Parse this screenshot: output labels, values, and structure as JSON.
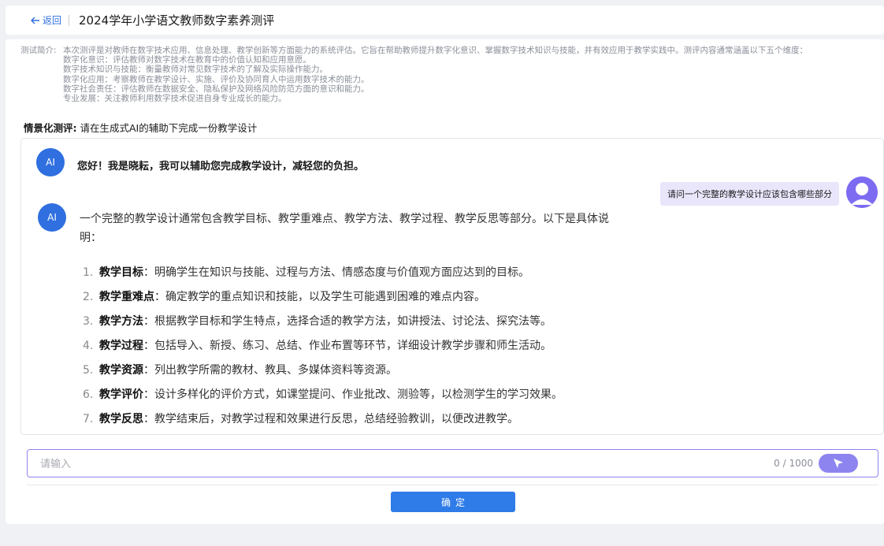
{
  "header": {
    "back_label": "返回",
    "title": "2024学年小学语文教师数字素养测评"
  },
  "intro": {
    "label": "测试简介:",
    "text": "本次测评是对教师在数字技术应用、信息处理、教学创新等方面能力的系统评估。它旨在帮助教师提升数字化意识、掌握数字技术知识与技能，并有效应用于教学实践中。测评内容通常涵盖以下五个维度：",
    "dimensions": [
      "数字化意识：评估教师对数字技术在教育中的价值认知和应用意愿。",
      "数字技术知识与技能：衡量教师对常见数字技术的了解及实际操作能力。",
      "数字化应用：考察教师在教学设计、实施、评价及协同育人中运用数字技术的能力。",
      "数字社会责任：评估教师在数据安全、隐私保护及网络风险防范方面的意识和能力。",
      "专业发展：关注教师利用数字技术促进自身专业成长的能力。"
    ]
  },
  "scenario": {
    "label": "情景化测评:",
    "text": "请在生成式AI的辅助下完成一份教学设计"
  },
  "chat": {
    "ai_avatar": "AI",
    "greeting": "您好！我是晓耘，我可以辅助您完成教学设计，减轻您的负担。",
    "user_question": "请问一个完整的教学设计应该包含哪些部分",
    "answer_intro": "一个完整的教学设计通常包含教学目标、教学重难点、教学方法、教学过程、教学反思等部分。以下是具体说明：",
    "answer_items": [
      {
        "num": "1.",
        "key": "教学目标",
        "text": "：明确学生在知识与技能、过程与方法、情感态度与价值观方面应达到的目标。"
      },
      {
        "num": "2.",
        "key": "教学重难点",
        "text": "：确定教学的重点知识和技能，以及学生可能遇到困难的难点内容。"
      },
      {
        "num": "3.",
        "key": "教学方法",
        "text": "：根据教学目标和学生特点，选择合适的教学方法，如讲授法、讨论法、探究法等。"
      },
      {
        "num": "4.",
        "key": "教学过程",
        "text": "：包括导入、新授、练习、总结、作业布置等环节，详细设计教学步骤和师生活动。"
      },
      {
        "num": "5.",
        "key": "教学资源",
        "text": "：列出教学所需的教材、教具、多媒体资料等资源。"
      },
      {
        "num": "6.",
        "key": "教学评价",
        "text": "：设计多样化的评价方式，如课堂提问、作业批改、测验等，以检测学生的学习效果。"
      },
      {
        "num": "7.",
        "key": "教学反思",
        "text": "：教学结束后，对教学过程和效果进行反思，总结经验教训，以便改进教学。"
      }
    ]
  },
  "input": {
    "placeholder": "请输入",
    "value": "",
    "counter": "0 / 1000"
  },
  "confirm_label": "确定",
  "icons": {
    "back": "arrow-left-icon",
    "send": "send-cursor-icon",
    "user": "user-avatar-icon"
  },
  "colors": {
    "accent": "#2f6fe0",
    "purple": "#8e84f0",
    "bubble": "#e9e6fb",
    "button": "#2f7be8"
  }
}
